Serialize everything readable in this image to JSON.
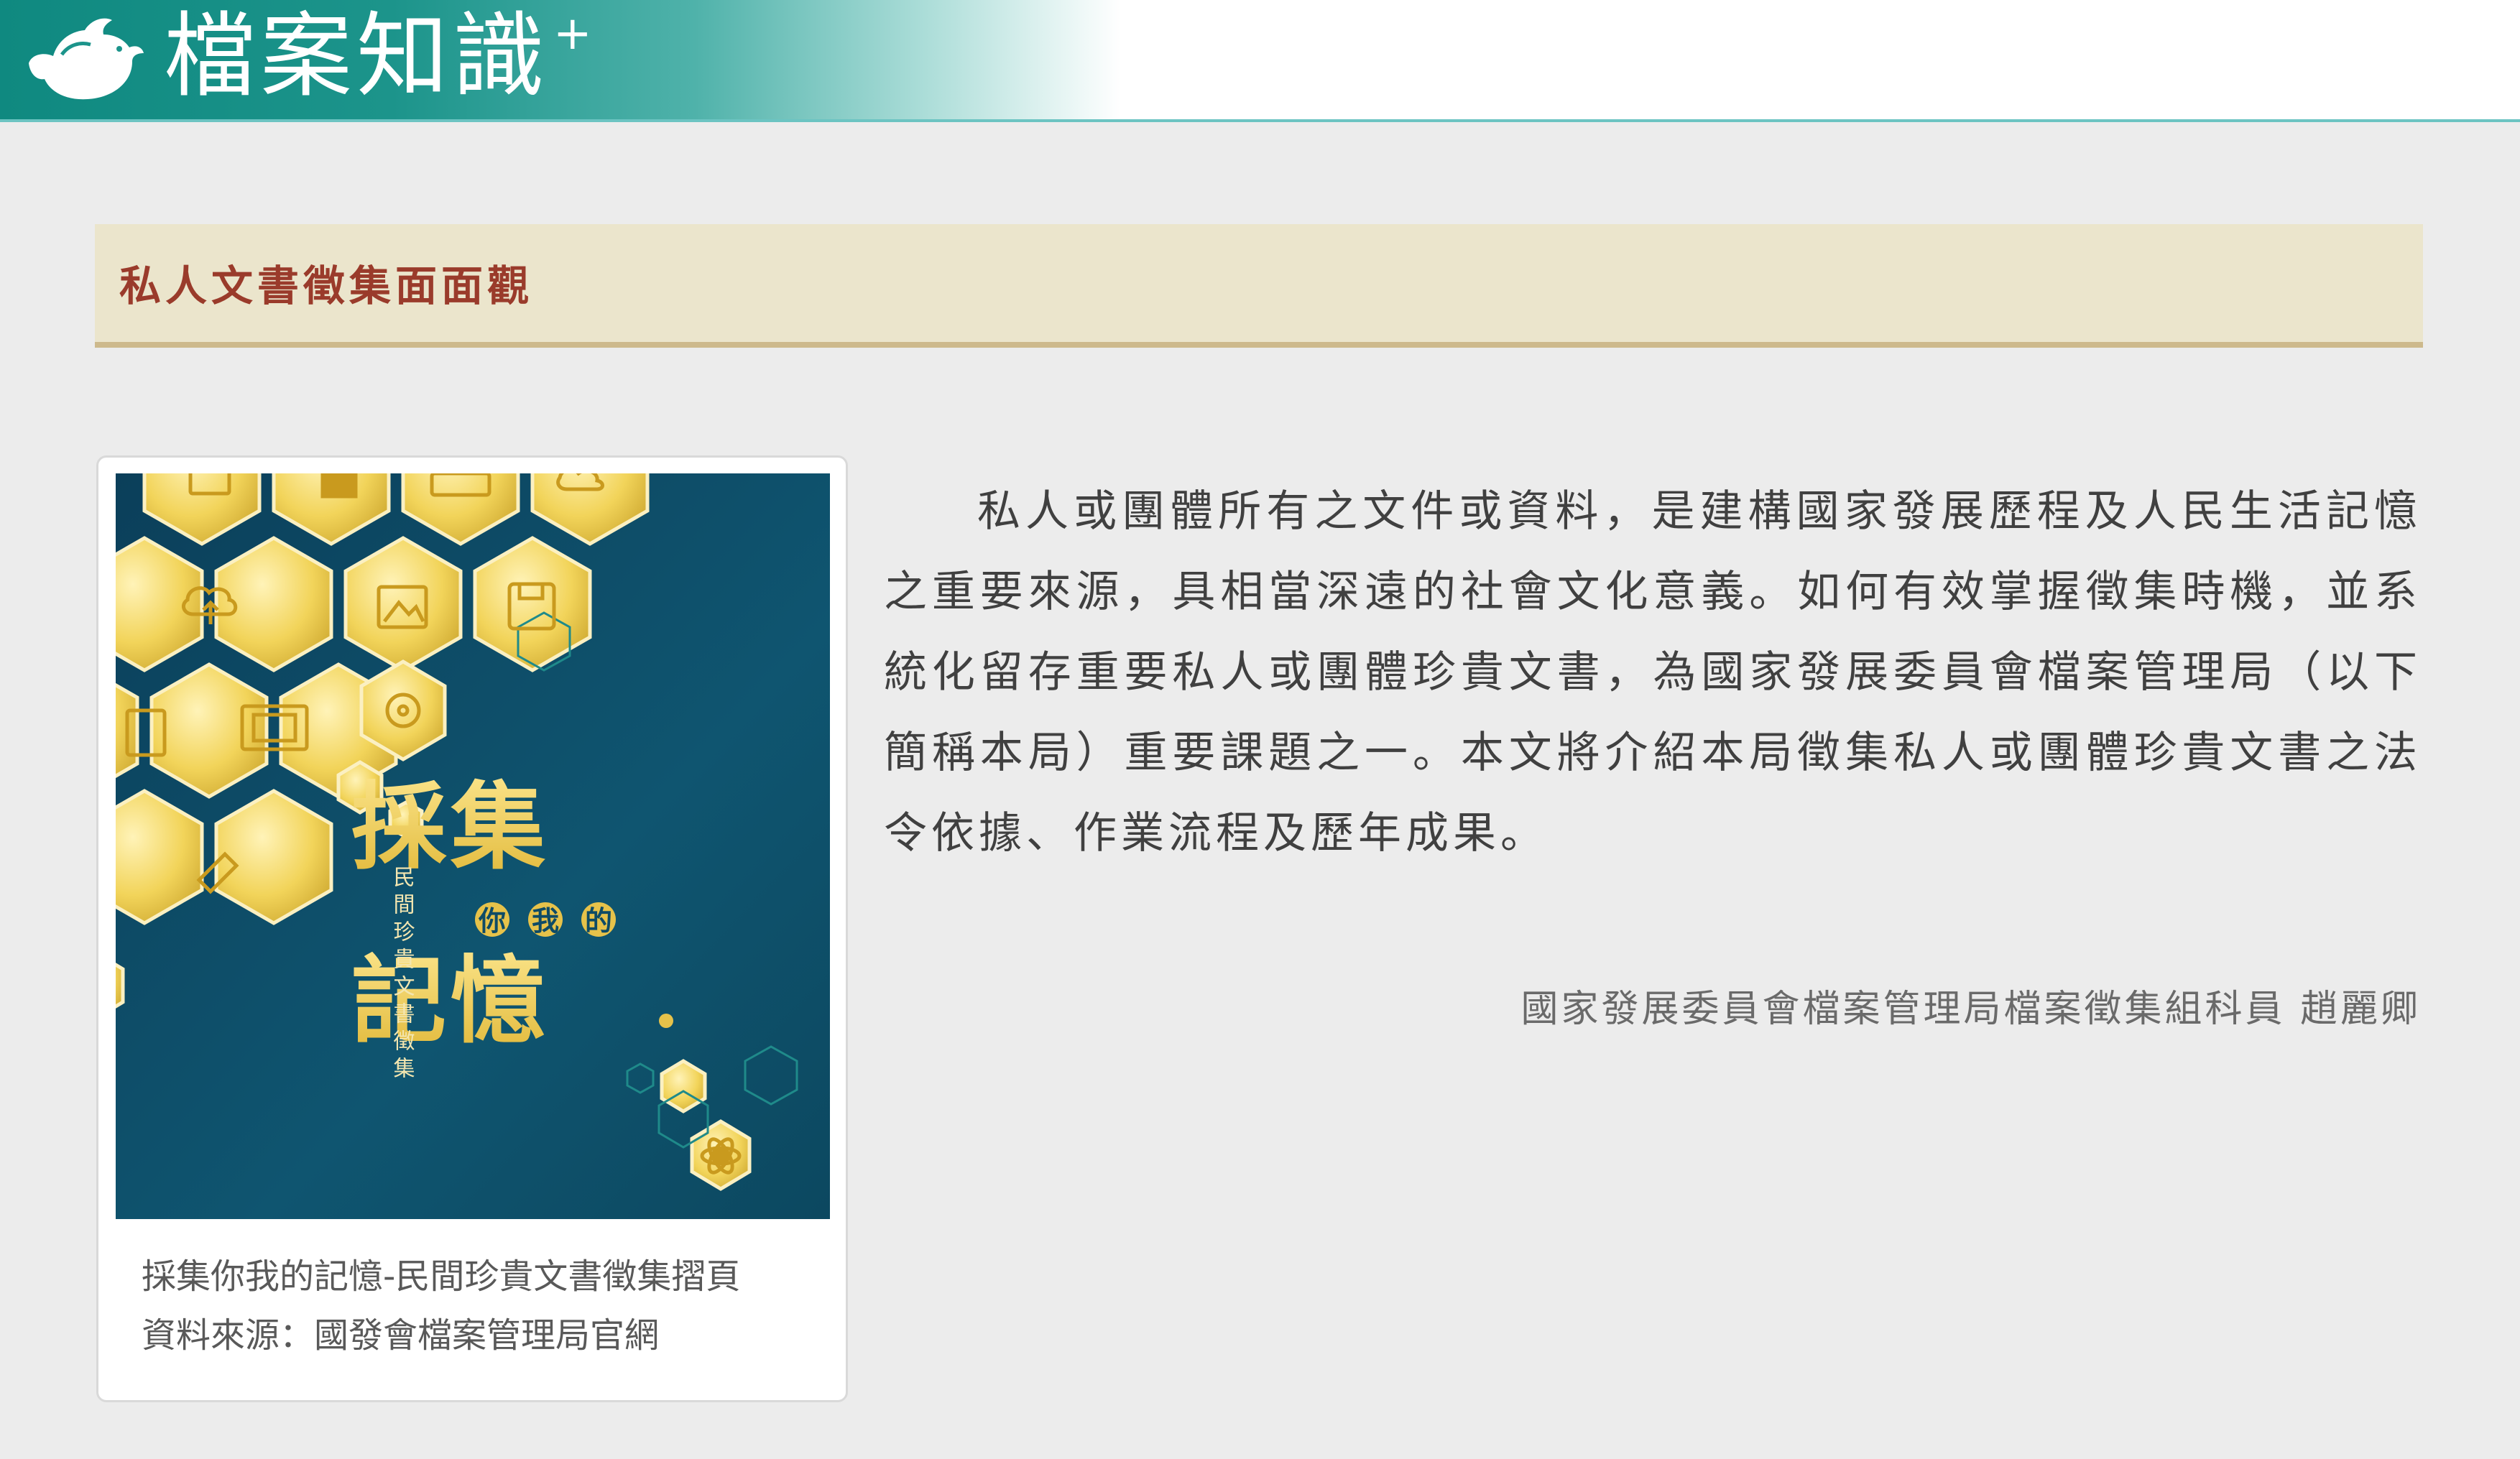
{
  "header": {
    "site_title": "檔案知識",
    "site_title_suffix": "+",
    "logo_icon": "bird-logo-icon"
  },
  "section": {
    "heading": "私人文書徵集面面觀"
  },
  "figure": {
    "cover": {
      "title_top": "採集",
      "title_middle": [
        "你",
        "我",
        "的"
      ],
      "title_bottom": "記憶",
      "subtitle_vertical": "民間珍貴文書徵集",
      "background_color": "#0e4b66",
      "accent_color": "#f0cd4a",
      "hex_icons": [
        "monitor-icon",
        "folder-icon",
        "keyboard-icon",
        "cloud-icon",
        "cloud-upload-icon",
        "image-icon",
        "floppy-disk-icon",
        "document-pen-icon",
        "photo-frame-icon",
        "disc-icon",
        "usb-drive-icon",
        "atom-icon"
      ]
    },
    "caption_title": "採集你我的記憶-民間珍貴文書徵集摺頁",
    "caption_source": "資料來源：國發會檔案管理局官網"
  },
  "article": {
    "body": "私人或團體所有之文件或資料，是建構國家發展歷程及人民生活記憶之重要來源，具相當深遠的社會文化意義。如何有效掌握徵集時機，並系統化留存重要私人或團體珍貴文書，為國家發展委員會檔案管理局（以下簡稱本局）重要課題之一。本文將介紹本局徵集私人或團體珍貴文書之法令依據、作業流程及歷年成果。",
    "author": "國家發展委員會檔案管理局檔案徵集組科員 趙麗卿"
  },
  "colors": {
    "header_teal": "#1c948b",
    "header_line": "#6cc4c2",
    "heading_bg": "#ebe5cc",
    "heading_border": "#cdb98c",
    "heading_text": "#9a3b2b",
    "page_bg": "#ececec"
  }
}
